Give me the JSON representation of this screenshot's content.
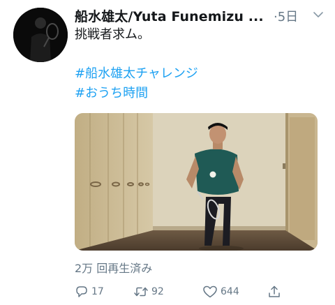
{
  "tweet": {
    "display_name": "船水雄太/Yuta Funemizu ...",
    "time": "·5日",
    "text": "挑戦者求ム。",
    "hashtags": [
      "#船水雄太チャレンジ",
      "#おうち時間"
    ],
    "view_count": "2万 回再生済み"
  },
  "actions": {
    "reply_count": "17",
    "retweet_count": "92",
    "like_count": "644"
  },
  "icons": {
    "more": "chevron-down-icon",
    "reply": "reply-icon",
    "retweet": "retweet-icon",
    "like": "heart-icon",
    "share": "share-icon"
  },
  "colors": {
    "hashtag": "#1da1f2",
    "secondary_text": "#657786",
    "text": "#14171a"
  }
}
